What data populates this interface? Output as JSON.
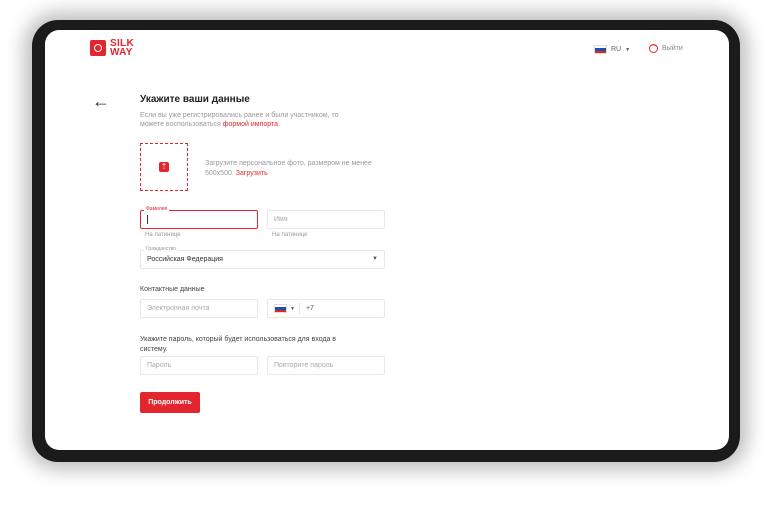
{
  "header": {
    "logo_line1": "SILK",
    "logo_line2": "WAY",
    "language": "RU",
    "logout_label": "Выйти"
  },
  "form": {
    "title": "Укажите ваши данные",
    "subtitle_text": "Если вы уже регистрировались ранее и были участником, то можете воспользоваться ",
    "subtitle_link": "формой импорта",
    "subtitle_end": ".",
    "photo_text": "Загрузите персональное фото, размером не менее 500х500. ",
    "photo_link": "Загрузить",
    "surname_label": "Фамилия",
    "surname_value": "",
    "surname_hint": "На латинице",
    "name_placeholder": "Имя",
    "name_hint": "На латинице",
    "citizenship_label": "Гражданство",
    "citizenship_value": "Российская Федерация",
    "contacts_label": "Контактные данные",
    "email_placeholder": "Электронная почта",
    "phone_prefix": "+7",
    "password_instruction": "Укажите пароль, который будет использоваться для входа в систему.",
    "password_placeholder": "Пароль",
    "password_repeat_placeholder": "Повторите пароль",
    "submit_label": "Продолжить"
  },
  "colors": {
    "accent": "#e3262e",
    "flag_white": "#ffffff",
    "flag_blue": "#1f4fb0",
    "flag_red": "#d52b1e"
  },
  "icons": {
    "back": "arrow-left-icon",
    "upload": "upload-icon",
    "logout": "logout-icon",
    "caret": "chevron-down-icon"
  }
}
